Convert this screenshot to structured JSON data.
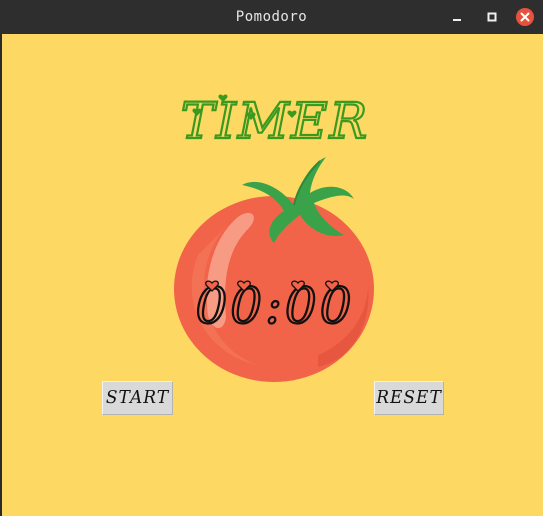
{
  "window": {
    "title": "Pomodoro",
    "controls": [
      "minimize-icon",
      "maximize-icon",
      "close-icon"
    ]
  },
  "app": {
    "heading": "TIMER",
    "timer_display": "00:00",
    "buttons": {
      "start": "START",
      "reset": "RESET"
    }
  },
  "colors": {
    "background": "#fdd964",
    "heading": "#3a9a20",
    "tomato": "#f26449",
    "leaf": "#3aa34a",
    "titlebar": "#2e2e2e",
    "close": "#e5533d"
  }
}
